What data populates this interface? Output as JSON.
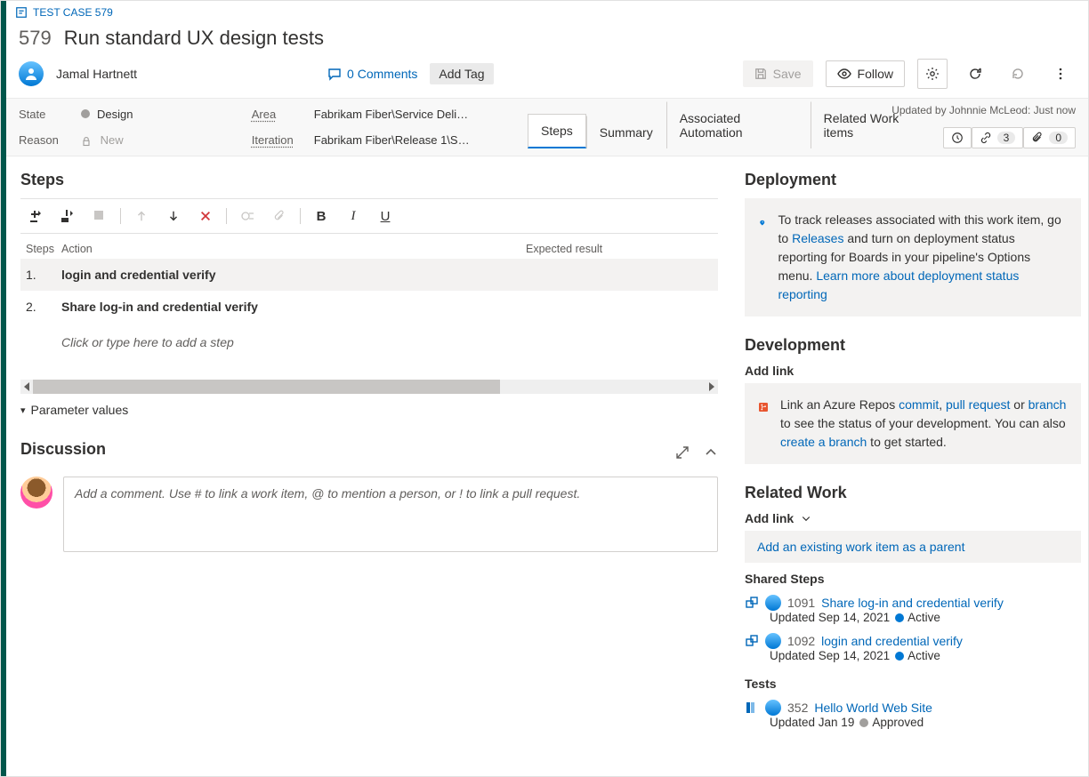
{
  "breadcrumb": {
    "label": "TEST CASE 579"
  },
  "workitem": {
    "id": "579",
    "title": "Run standard UX design tests",
    "assignee": "Jamal Hartnett",
    "comments_label": "0 Comments",
    "add_tag_label": "Add Tag"
  },
  "toolbar_top": {
    "save": "Save",
    "follow": "Follow"
  },
  "fields": {
    "state_label": "State",
    "state_value": "Design",
    "reason_label": "Reason",
    "reason_value": "New",
    "area_label": "Area",
    "area_value": "Fabrikam Fiber\\Service Deli…",
    "iteration_label": "Iteration",
    "iteration_value": "Fabrikam Fiber\\Release 1\\S…"
  },
  "updated_by": "Updated by Johnnie McLeod: Just now",
  "tabs": {
    "steps": "Steps",
    "summary": "Summary",
    "automation": "Associated Automation",
    "related": "Related Work items",
    "links_count": "3",
    "attach_count": "0"
  },
  "steps": {
    "heading": "Steps",
    "col_steps": "Steps",
    "col_action": "Action",
    "col_expected": "Expected result",
    "rows": [
      {
        "n": "1.",
        "action": "login and credential verify"
      },
      {
        "n": "2.",
        "action": "Share log-in and credential verify"
      }
    ],
    "placeholder": "Click or type here to add a step",
    "param_label": "Parameter values"
  },
  "discussion": {
    "heading": "Discussion",
    "placeholder": "Add a comment. Use # to link a work item, @ to mention a person, or ! to link a pull request."
  },
  "deployment": {
    "heading": "Deployment",
    "text_pre": "To track releases associated with this work item, go to ",
    "link1": "Releases",
    "text_mid": " and turn on deployment status reporting for Boards in your pipeline's Options menu. ",
    "link2": "Learn more about deployment status reporting"
  },
  "development": {
    "heading": "Development",
    "addlink": "Add link",
    "text1": "Link an Azure Repos ",
    "commit": "commit",
    "pr": "pull request",
    "or": " or ",
    "branch": "branch",
    "text2": " to see the status of your development. You can also ",
    "create": "create a branch",
    "text3": " to get started."
  },
  "related": {
    "heading": "Related Work",
    "addlink": "Add link",
    "add_parent": "Add an existing work item as a parent",
    "shared_steps": "Shared Steps",
    "tests": "Tests",
    "items": [
      {
        "id": "1091",
        "title": "Share log-in and credential verify",
        "updated": "Updated Sep 14, 2021",
        "status": "Active",
        "status_class": "active"
      },
      {
        "id": "1092",
        "title": "login and credential verify",
        "updated": "Updated Sep 14, 2021",
        "status": "Active",
        "status_class": "active"
      }
    ],
    "tests_items": [
      {
        "id": "352",
        "title": "Hello World Web Site",
        "updated": "Updated Jan 19",
        "status": "Approved",
        "status_class": "approved"
      }
    ]
  }
}
